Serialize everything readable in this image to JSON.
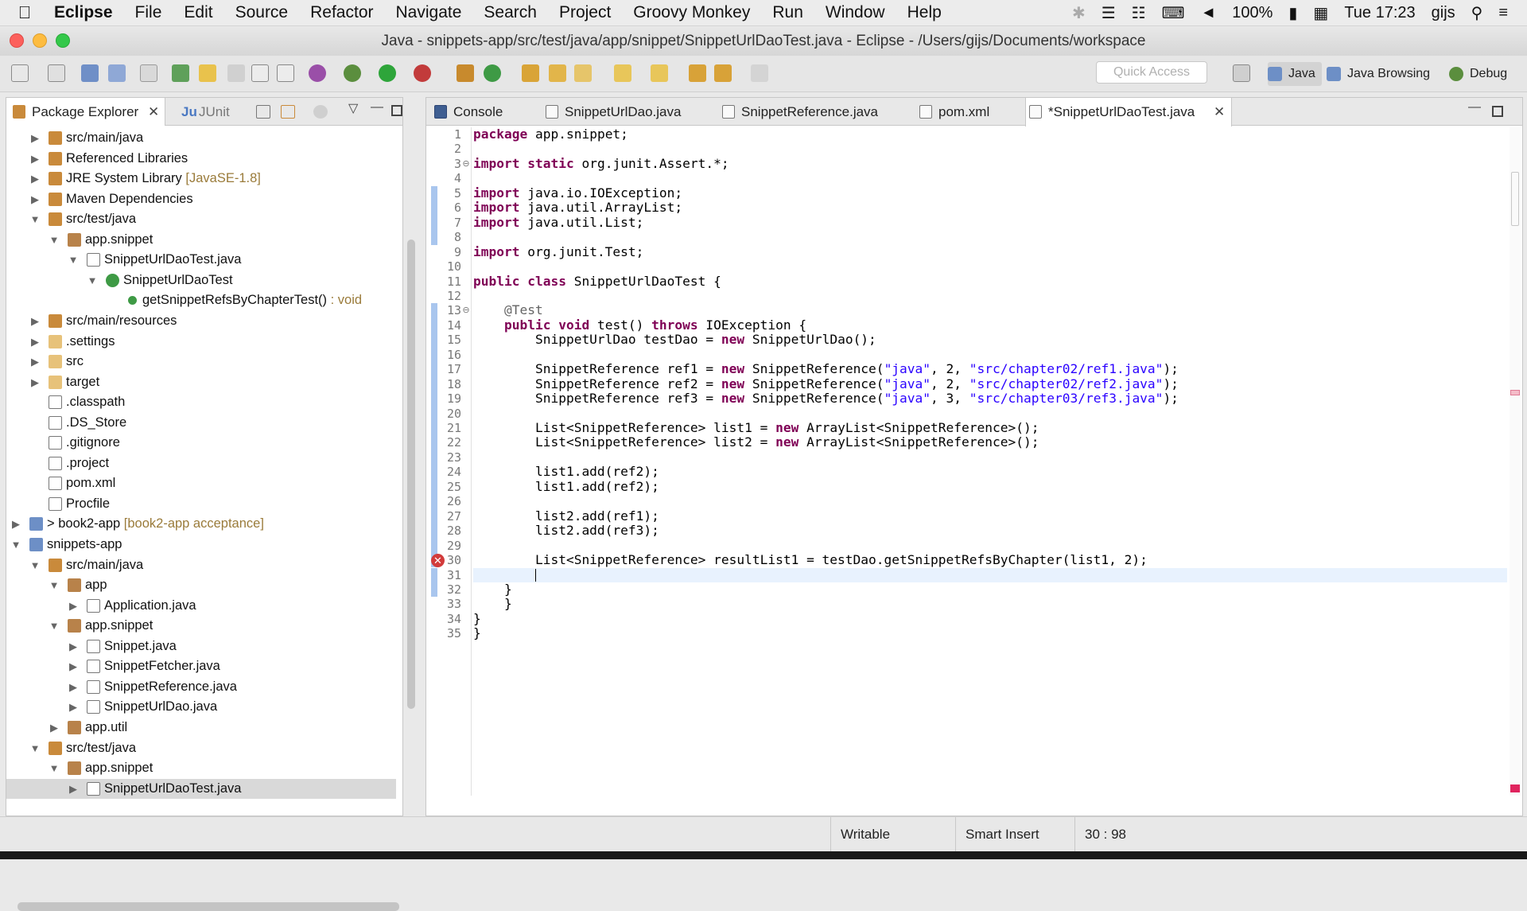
{
  "macos_menubar": {
    "app_name": "Eclipse",
    "menus": [
      "File",
      "Edit",
      "Source",
      "Refactor",
      "Navigate",
      "Search",
      "Project",
      "Groovy Monkey",
      "Run",
      "Window",
      "Help"
    ],
    "battery": "100%",
    "clock": "Tue 17:23",
    "user": "gijs"
  },
  "window": {
    "title": "Java - snippets-app/src/test/java/app/snippet/SnippetUrlDaoTest.java - Eclipse - /Users/gijs/Documents/workspace"
  },
  "toolbar": {
    "quick_access_placeholder": "Quick Access",
    "perspectives": [
      "Java",
      "Java Browsing",
      "Debug"
    ]
  },
  "left_panel": {
    "tabs": [
      "Package Explorer",
      "JUnit"
    ],
    "tree": [
      {
        "label": "src/main/java",
        "expanded": false,
        "icon": "source-folder-icon"
      },
      {
        "label": "Referenced Libraries",
        "expanded": false,
        "icon": "library-icon"
      },
      {
        "label": "JRE System Library",
        "decoration": "[JavaSE-1.8]",
        "expanded": false,
        "icon": "library-icon"
      },
      {
        "label": "Maven Dependencies",
        "expanded": false,
        "icon": "library-icon"
      },
      {
        "label": "src/test/java",
        "expanded": true,
        "icon": "source-folder-icon"
      },
      {
        "label": "app.snippet",
        "expanded": true,
        "icon": "package-icon"
      },
      {
        "label": "SnippetUrlDaoTest.java",
        "expanded": true,
        "icon": "java-file-icon"
      },
      {
        "label": "SnippetUrlDaoTest",
        "expanded": true,
        "icon": "class-icon"
      },
      {
        "label": "getSnippetRefsByChapterTest()",
        "decoration": ": void",
        "expanded": null,
        "icon": "method-icon"
      },
      {
        "label": "src/main/resources",
        "expanded": false,
        "icon": "source-folder-icon"
      },
      {
        "label": ".settings",
        "expanded": false,
        "icon": "folder-icon"
      },
      {
        "label": "src",
        "expanded": false,
        "icon": "folder-icon"
      },
      {
        "label": "target",
        "expanded": false,
        "icon": "folder-icon"
      },
      {
        "label": ".classpath",
        "expanded": null,
        "icon": "xml-file-icon"
      },
      {
        "label": ".DS_Store",
        "expanded": null,
        "icon": "file-icon"
      },
      {
        "label": ".gitignore",
        "expanded": null,
        "icon": "file-icon"
      },
      {
        "label": ".project",
        "expanded": null,
        "icon": "xml-file-icon"
      },
      {
        "label": "pom.xml",
        "expanded": null,
        "icon": "xml-file-icon"
      },
      {
        "label": "Procfile",
        "expanded": null,
        "icon": "file-icon"
      },
      {
        "label": "> book2-app",
        "decoration": "[book2-app acceptance]",
        "expanded": false,
        "icon": "project-icon"
      },
      {
        "label": "snippets-app",
        "expanded": true,
        "icon": "project-icon"
      },
      {
        "label": "src/main/java",
        "expanded": true,
        "icon": "source-folder-icon"
      },
      {
        "label": "app",
        "expanded": true,
        "icon": "package-icon"
      },
      {
        "label": "Application.java",
        "expanded": false,
        "icon": "java-file-icon"
      },
      {
        "label": "app.snippet",
        "expanded": true,
        "icon": "package-icon"
      },
      {
        "label": "Snippet.java",
        "expanded": false,
        "icon": "java-file-icon"
      },
      {
        "label": "SnippetFetcher.java",
        "expanded": false,
        "icon": "java-file-icon"
      },
      {
        "label": "SnippetReference.java",
        "expanded": false,
        "icon": "java-file-icon"
      },
      {
        "label": "SnippetUrlDao.java",
        "expanded": false,
        "icon": "java-file-icon"
      },
      {
        "label": "app.util",
        "expanded": false,
        "icon": "package-icon"
      },
      {
        "label": "src/test/java",
        "expanded": true,
        "icon": "source-folder-icon"
      },
      {
        "label": "app.snippet",
        "expanded": true,
        "icon": "package-icon"
      },
      {
        "label": "SnippetUrlDaoTest.java",
        "expanded": false,
        "icon": "java-file-icon",
        "selected": true
      }
    ]
  },
  "editor": {
    "tabs": [
      {
        "label": "Console",
        "active": false
      },
      {
        "label": "SnippetUrlDao.java",
        "active": false
      },
      {
        "label": "SnippetReference.java",
        "active": false
      },
      {
        "label": "pom.xml",
        "active": false
      },
      {
        "label": "*SnippetUrlDaoTest.java",
        "active": true
      }
    ],
    "lines": [
      "package app.snippet;",
      "",
      "import static org.junit.Assert.*;",
      "",
      "import java.io.IOException;",
      "import java.util.ArrayList;",
      "import java.util.List;",
      "",
      "import org.junit.Test;",
      "",
      "public class SnippetUrlDaoTest {",
      "",
      "    @Test",
      "    public void test() throws IOException {",
      "        SnippetUrlDao testDao = new SnippetUrlDao();",
      "",
      "        SnippetReference ref1 = new SnippetReference(\"java\", 2, \"src/chapter02/ref1.java\");",
      "        SnippetReference ref2 = new SnippetReference(\"java\", 2, \"src/chapter02/ref2.java\");",
      "        SnippetReference ref3 = new SnippetReference(\"java\", 3, \"src/chapter03/ref3.java\");",
      "",
      "        List<SnippetReference> list1 = new ArrayList<SnippetReference>();",
      "        List<SnippetReference> list2 = new ArrayList<SnippetReference>();",
      "",
      "        list1.add(ref2);",
      "        list1.add(ref2);",
      "",
      "        list2.add(ref1);",
      "        list2.add(ref3);",
      "",
      "        List<SnippetReference> resultList1 = testDao.getSnippetRefsByChapter(list1, 2);",
      "        ",
      "    }",
      "    }",
      "}",
      "}"
    ],
    "error_line": 30,
    "current_line": 31
  },
  "status_bar": {
    "writable": "Writable",
    "insert_mode": "Smart Insert",
    "position": "30 : 98"
  },
  "colors": {
    "keyword": "#7f0055",
    "string": "#2a00ff",
    "annotation": "#646464",
    "error": "#d23b3b",
    "current_line": "#e8f2fe"
  }
}
